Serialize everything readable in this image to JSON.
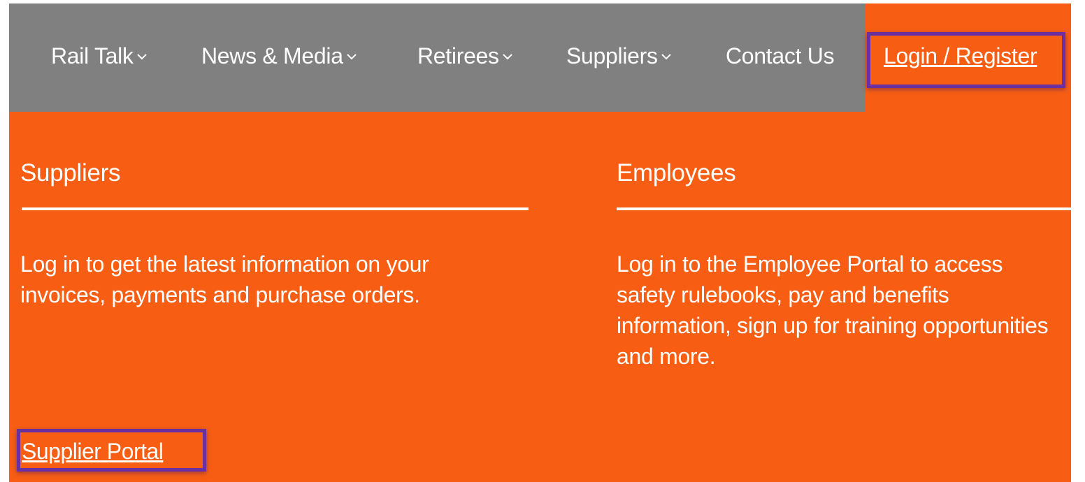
{
  "nav": {
    "items": [
      {
        "label": "Rail Talk",
        "has_dropdown": true
      },
      {
        "label": "News & Media",
        "has_dropdown": true
      },
      {
        "label": "Retirees",
        "has_dropdown": true
      },
      {
        "label": "Suppliers",
        "has_dropdown": true
      },
      {
        "label": "Contact Us",
        "has_dropdown": false
      }
    ],
    "login_label": "Login / Register"
  },
  "panel": {
    "suppliers": {
      "title": "Suppliers",
      "text": "Log in to get the latest information on your\ninvoices, payments and purchase orders.",
      "link_label": "Supplier Portal"
    },
    "employees": {
      "title": "Employees",
      "text": "Log in to the Employee Portal to access\nsafety rulebooks, pay and benefits\ninformation, sign up for training opportunities\nand more."
    }
  },
  "colors": {
    "nav_bg": "#808080",
    "accent": "#f75e14",
    "highlight_border": "#6a2fa0"
  }
}
